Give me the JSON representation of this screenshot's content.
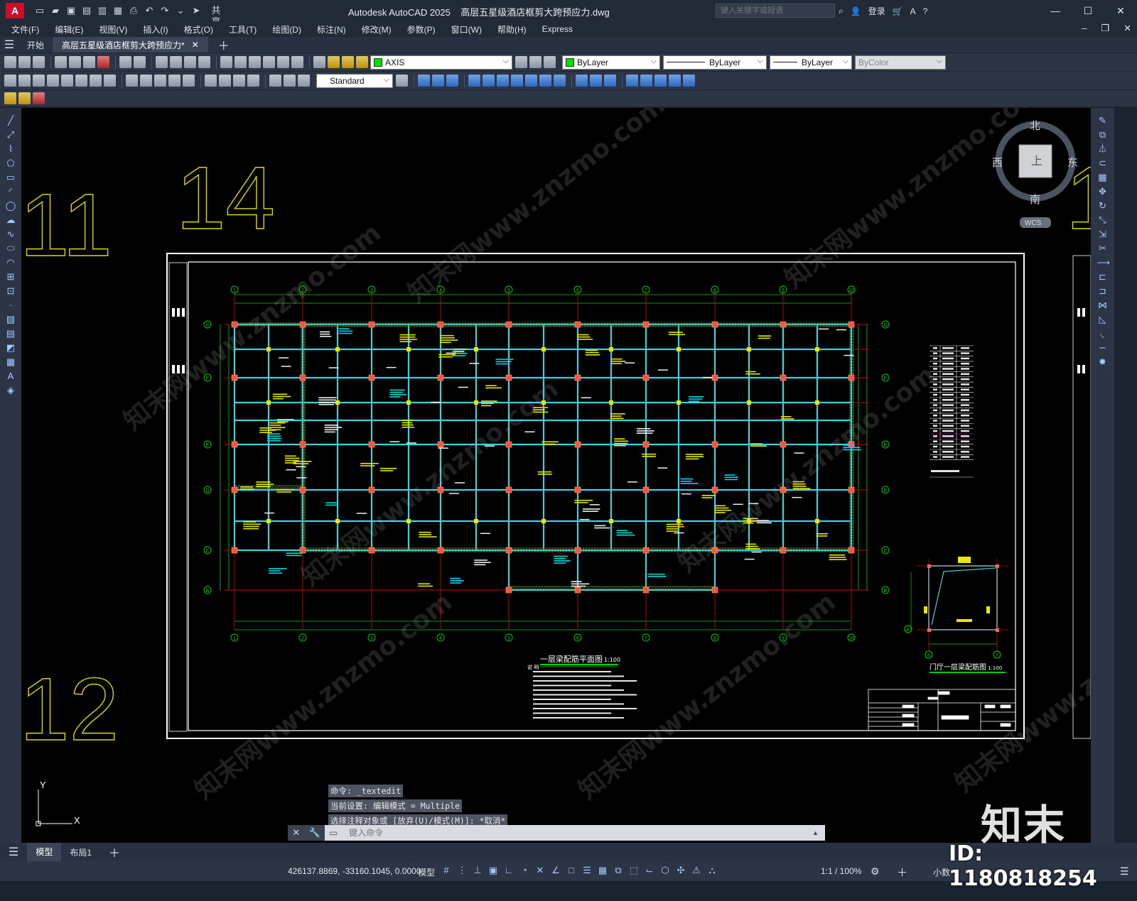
{
  "app": {
    "name": "Autodesk AutoCAD 2025",
    "file": "高层五星级酒店框剪大跨预应力.dwg",
    "share": "共享"
  },
  "search": {
    "placeholder": "键入关键字或短语"
  },
  "account": {
    "login": "登录"
  },
  "menu": [
    "文件(F)",
    "编辑(E)",
    "视图(V)",
    "插入(I)",
    "格式(O)",
    "工具(T)",
    "绘图(D)",
    "标注(N)",
    "修改(M)",
    "参数(P)",
    "窗口(W)",
    "帮助(H)",
    "Express"
  ],
  "tabs": {
    "start": "开始",
    "doc": "高层五星级酒店框剪大跨预应力*"
  },
  "props": {
    "layer": "AXIS",
    "color": "ByLayer",
    "linetype": "ByLayer",
    "lineweight": "ByLayer",
    "plotstyle": "ByColor",
    "textstyle": "Standard"
  },
  "viewcube": {
    "north": "北",
    "south": "南",
    "east": "东",
    "west": "西",
    "top": "上",
    "wcs": "WCS"
  },
  "drawing": {
    "big_numbers": [
      "11",
      "14",
      "12",
      "1"
    ],
    "axis_top": [
      "1",
      "2",
      "3",
      "4",
      "5",
      "6",
      "7",
      "8",
      "9",
      "10"
    ],
    "axis_side": [
      "G",
      "F",
      "E",
      "D",
      "C",
      "B"
    ],
    "main_title": "一层梁配筋平面图",
    "main_scale": "1:100",
    "sub_title": "门厅一层梁配筋图",
    "sub_scale": "1:100",
    "sub_axes": {
      "left": "6",
      "right": "7",
      "side": "A"
    },
    "notes_heading": "说 明"
  },
  "ucs": {
    "x": "X",
    "y": "Y"
  },
  "command": {
    "history": [
      "命令: _textedit",
      "当前设置: 编辑模式 = Multiple",
      "选择注释对象或 [放弃(U)/模式(M)]: *取消*"
    ],
    "placeholder": "键入命令"
  },
  "layouts": {
    "model": "模型",
    "layout1": "布局1"
  },
  "status": {
    "coords": "426137.8869, -33160.1045, 0.0000",
    "model": "模型",
    "scale": "1:1 / 100%",
    "units": "小数"
  },
  "watermark": {
    "id": "ID: 1180818254",
    "logo": "知末",
    "diag": "知末网www.znzmo.com"
  }
}
